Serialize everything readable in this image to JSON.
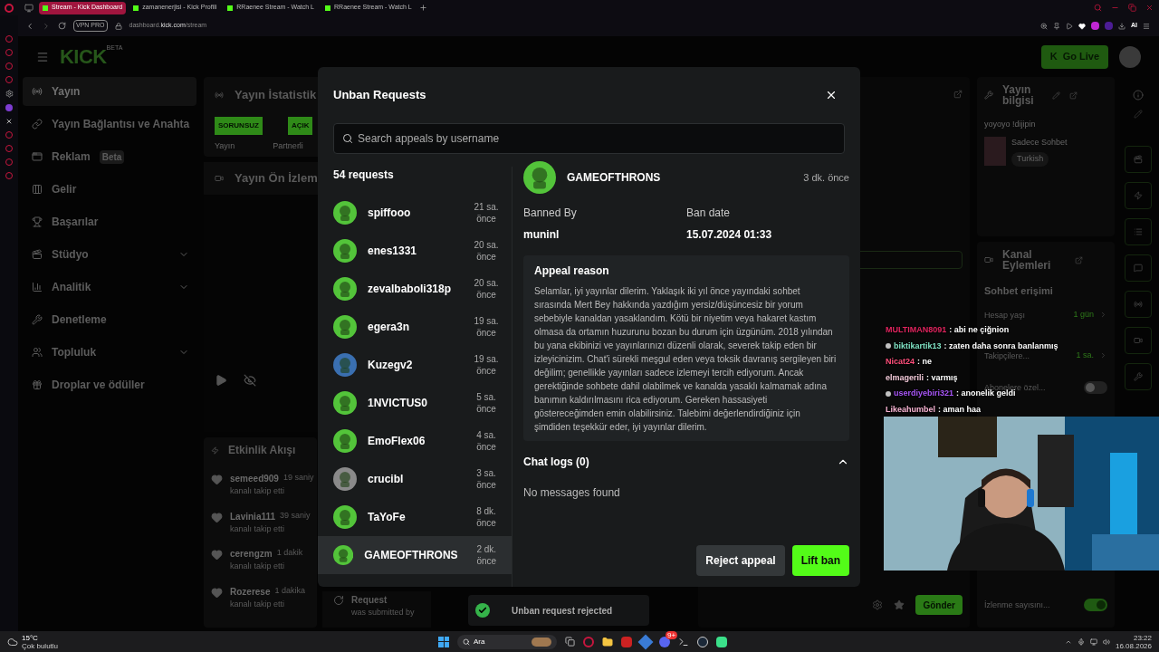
{
  "browser": {
    "tabs": [
      {
        "label": "Stream - Kick Dashboard",
        "selected": true
      },
      {
        "label": "zamanenerjisi - Kick Profili",
        "selected": false
      },
      {
        "label": "RRaenee Stream - Watch L",
        "selected": false
      },
      {
        "label": "RRaenee Stream - Watch L",
        "selected": false
      }
    ],
    "vpn_badge": "VPN PRO",
    "url_domain": "dashboard.",
    "url_host": "kick.com",
    "url_path": "/stream",
    "ai_label": "AI"
  },
  "header": {
    "logo": "KICK",
    "logo_badge": "BETA",
    "go_live_mark": "K",
    "go_live": "Go Live"
  },
  "nav": [
    {
      "label": "Yayın",
      "selected": true
    },
    {
      "label": "Yayın Bağlantısı ve Anahta",
      "selected": false
    },
    {
      "label": "Reklam",
      "badge": "Beta",
      "selected": false
    },
    {
      "label": "Gelir",
      "selected": false
    },
    {
      "label": "Başarılar",
      "selected": false
    },
    {
      "label": "Stüdyo",
      "selected": false,
      "expanded": false
    },
    {
      "label": "Analitik",
      "selected": false,
      "expanded": false
    },
    {
      "label": "Denetleme",
      "selected": false
    },
    {
      "label": "Topluluk",
      "selected": false,
      "expanded": false
    },
    {
      "label": "Droplar ve ödüller",
      "selected": false
    }
  ],
  "stats_panel": {
    "title": "Yayın İstatistik",
    "badges": [
      "SORUNSUZ",
      "AÇIK"
    ],
    "labels": [
      "Yayın",
      "Partnerli"
    ]
  },
  "preview_panel": {
    "title": "Yayın Ön İzlem"
  },
  "activity": {
    "title": "Etkinlik Akışı",
    "items": [
      {
        "user": "semeed909",
        "time": "19 saniy",
        "action": "kanalı takip etti"
      },
      {
        "user": "Lavinia111",
        "time": "39 saniy",
        "action": "kanalı takip etti"
      },
      {
        "user": "cerengzm",
        "time": "1 dakik",
        "action": "kanalı takip etti"
      },
      {
        "user": "Rozerese",
        "time": "1 dakika",
        "action": "kanalı takip etti"
      }
    ]
  },
  "request_card": {
    "title": "Request",
    "subtitle": "was submitted by"
  },
  "chat": {
    "send": "Gönder"
  },
  "stream_info": {
    "title": "Yayın bilgisi",
    "stream_title": "yoyoyo !dijipin",
    "category": "Sadece Sohbet",
    "language": "Turkish"
  },
  "channel_actions": {
    "title": "Kanal Eylemleri",
    "section": "Sohbet erişimi",
    "rows": [
      {
        "kind": "value",
        "label": "Hesap yaşı",
        "value": "1 gün"
      },
      {
        "kind": "value",
        "label": "Takipçilere...",
        "value": "1 sa."
      },
      {
        "kind": "toggle",
        "label": "Abonelere özel...",
        "on": false
      },
      {
        "kind": "toggle",
        "label": "İzlenme sayısını...",
        "on": true
      }
    ]
  },
  "modal": {
    "title": "Unban Requests",
    "search_placeholder": "Search appeals by username",
    "count": "54 requests",
    "requests": [
      {
        "user": "spiffooo",
        "time": "21 sa. önce",
        "color": "#53c43a",
        "selected": false
      },
      {
        "user": "enes1331",
        "time": "20 sa. önce",
        "color": "#53c43a",
        "selected": false
      },
      {
        "user": "zevalbaboli318p",
        "time": "20 sa. önce",
        "color": "#53c43a",
        "selected": false
      },
      {
        "user": "egera3n",
        "time": "19 sa. önce",
        "color": "#53c43a",
        "selected": false
      },
      {
        "user": "Kuzegv2",
        "time": "19 sa. önce",
        "color": "#3a6fb0",
        "selected": false
      },
      {
        "user": "1NVICTUS0",
        "time": "5 sa. önce",
        "color": "#53c43a",
        "selected": false
      },
      {
        "user": "EmoFlex06",
        "time": "4 sa. önce",
        "color": "#53c43a",
        "selected": false
      },
      {
        "user": "crucibl",
        "time": "3 sa. önce",
        "color": "#8a8a8a",
        "selected": false
      },
      {
        "user": "TaYoFe",
        "time": "8 dk. önce",
        "color": "#53c43a",
        "selected": false
      },
      {
        "user": "GAMEOFTHRONS",
        "time": "2 dk. önce",
        "color": "#53c43a",
        "selected": true
      }
    ],
    "detail": {
      "user": "GAMEOFTHRONS",
      "time": "3 dk. önce",
      "banned_by_label": "Banned By",
      "banned_by": "muninl",
      "ban_date_label": "Ban date",
      "ban_date": "15.07.2024 01:33",
      "reason_title": "Appeal reason",
      "reason": "Selamlar, iyi yayınlar dilerim. Yaklaşık iki yıl önce yayındaki sohbet sırasında Mert Bey hakkında yazdığım yersiz/düşüncesiz bir yorum sebebiyle kanaldan yasaklandım. Kötü bir niyetim veya hakaret kastım olmasa da ortamın huzurunu bozan bu durum için üzgünüm. 2018 yılından bu yana ekibinizi ve yayınlarınızı düzenli olarak, severek takip eden bir izleyicinizim. Chat'i sürekli meşgul eden veya toksik davranış sergileyen biri değilim; genellikle yayınları sadece izlemeyi tercih ediyorum. Ancak gerektiğinde sohbete dahil olabilmek ve kanalda yasaklı kalmamak adına banımın kaldırılmasını rica ediyorum. Gereken hassasiyeti göstereceğimden emin olabilirsiniz. Talebimi değerlendirdiğiniz için şimdiden teşekkür eder, iyi yayınlar dilerim.",
      "chat_logs": "Chat logs (0)",
      "chat_logs_expanded": true,
      "empty": "No messages found"
    },
    "reject": "Reject appeal",
    "lift": "Lift ban"
  },
  "toast": {
    "message": "Unban request rejected"
  },
  "overlay_chat": [
    {
      "user": "MULTIMAN8091",
      "color": "#e0245e",
      "text": ": abi ne çiğnion",
      "badge": false
    },
    {
      "user": "biktikartik13",
      "color": "#7fe3c4",
      "text": ": zaten daha sonra banlanmış",
      "badge": true
    },
    {
      "user": "Nicat24",
      "color": "#ff4f7b",
      "text": ": ne",
      "badge": false
    },
    {
      "user": "elmagerili",
      "color": "#f2c9d8",
      "text": ": varmış",
      "badge": false
    },
    {
      "user": "userdiyebiri321",
      "color": "#a855f7",
      "text": ": anonelik geldi",
      "badge": true
    },
    {
      "user": "Likeahumbel",
      "color": "#f7b3d2",
      "text": ": aman haa",
      "badge": false
    }
  ],
  "taskbar": {
    "temp": "15°C",
    "weather": "Çok bulutlu",
    "search": "Ara",
    "discord_badge": "9+",
    "time": "23:22",
    "date": "16.08.2026"
  }
}
